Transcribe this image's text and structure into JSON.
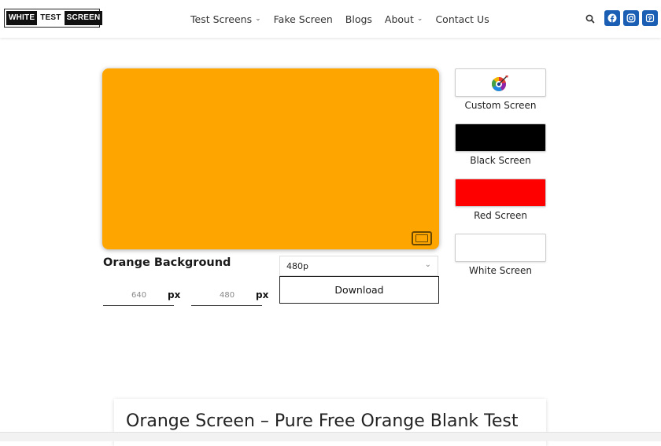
{
  "header": {
    "logo": {
      "word1": "WHITE",
      "word2": "TEST",
      "word3": "SCREEN"
    },
    "nav": [
      {
        "label": "Test Screens",
        "has_dropdown": true
      },
      {
        "label": "Fake Screen",
        "has_dropdown": false
      },
      {
        "label": "Blogs",
        "has_dropdown": false
      },
      {
        "label": "About",
        "has_dropdown": true
      },
      {
        "label": "Contact Us",
        "has_dropdown": false
      }
    ],
    "chevron": "⌄",
    "icons": [
      "search-icon",
      "facebook-icon",
      "instagram-icon",
      "pinterest-icon"
    ],
    "social_color": "#1a5fb4"
  },
  "main": {
    "preview_color": "#FFA500",
    "background_title": "Orange Background",
    "width_value": "640",
    "height_value": "480",
    "unit_label": "px",
    "resolution_selected": "480p",
    "resolution_chevron": "⌄",
    "download_label": "Download"
  },
  "sidebar": {
    "swatches": [
      {
        "label": "Custom Screen",
        "color": "#ffffff",
        "icon": "color-wheel-icon"
      },
      {
        "label": "Black Screen",
        "color": "#000000"
      },
      {
        "label": "Red Screen",
        "color": "#ff0000"
      },
      {
        "label": "White Screen",
        "color": "#ffffff"
      }
    ]
  },
  "article": {
    "title": "Orange Screen – Pure Free Orange Blank Test"
  }
}
